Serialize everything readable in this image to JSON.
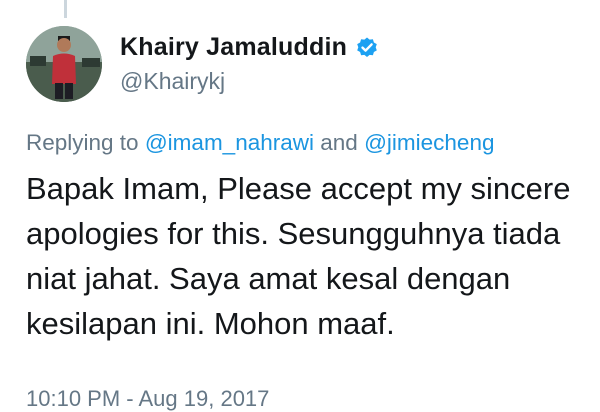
{
  "tweet": {
    "author": {
      "name": "Khairy Jamaluddin",
      "handle": "@Khairykj",
      "verified": true,
      "avatar_icon": "profile-photo"
    },
    "replying_prefix": "Replying to",
    "mention_1": "@imam_nahrawi",
    "conjunction": "and",
    "mention_2": "@jimiecheng",
    "body_lines": [
      "Bapak Imam, Please accept my sincere",
      "apologies for this. Sesungguhnya tiada",
      "niat jahat. Saya amat kesal dengan",
      "kesilapan ini. Mohon maaf."
    ],
    "timestamp": "10:10 PM - Aug 19, 2017"
  },
  "colors": {
    "text_primary": "#14171a",
    "text_secondary": "#657786",
    "link": "#1b95e0",
    "verified_badge": "#1da1f2"
  }
}
